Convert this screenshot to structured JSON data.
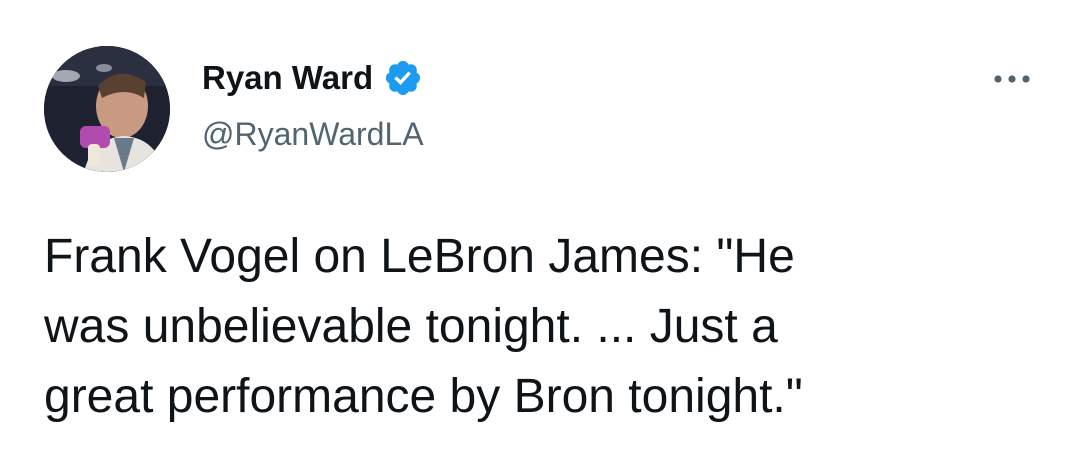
{
  "author": {
    "display_name": "Ryan Ward",
    "handle": "@RyanWardLA",
    "verified": true
  },
  "tweet": {
    "text": "Frank Vogel on LeBron James: \"He\nwas unbelievable tonight. ... Just a\ngreat performance by Bron tonight.\""
  },
  "icons": {
    "verified": "verified-badge-icon",
    "more": "more-options-icon"
  },
  "colors": {
    "verified_blue": "#1d9bf0",
    "text": "#0f1419",
    "secondary_text": "#536471"
  }
}
